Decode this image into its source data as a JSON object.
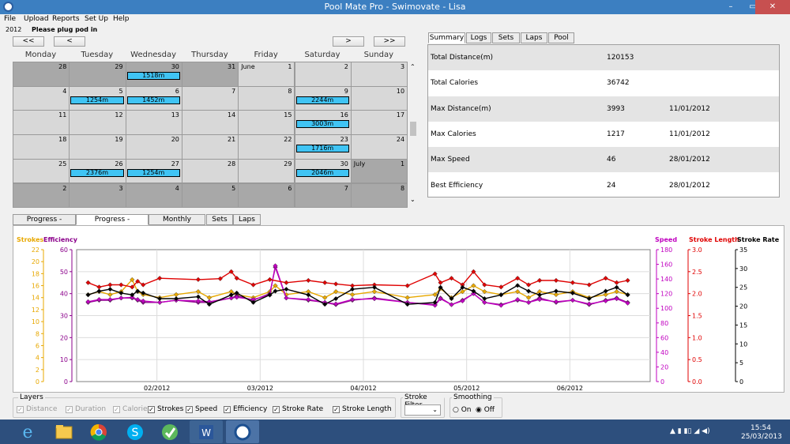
{
  "window": {
    "title": "Pool Mate Pro - Swimovate - Lisa",
    "minimize": "–",
    "maximize": "▭",
    "close": "✕"
  },
  "menu": [
    "File",
    "Upload",
    "Reports",
    "Set Up",
    "Help"
  ],
  "status": {
    "year": "2012",
    "message": "Please plug pod in"
  },
  "nav": {
    "first": "<<",
    "prev": "<",
    "next": ">",
    "last": ">>"
  },
  "days": [
    "Monday",
    "Tuesday",
    "Wednesday",
    "Thursday",
    "Friday",
    "Saturday",
    "Sunday"
  ],
  "calendar": {
    "weeks": [
      [
        {
          "n": "28",
          "t": "o"
        },
        {
          "n": "29",
          "t": "o"
        },
        {
          "n": "30",
          "t": "o",
          "s": "1518m"
        },
        {
          "n": "31",
          "t": "o"
        },
        {
          "n": "1",
          "t": "c",
          "m": "June"
        },
        {
          "n": "2",
          "t": "c"
        },
        {
          "n": "3",
          "t": "c"
        }
      ],
      [
        {
          "n": "4",
          "t": "c"
        },
        {
          "n": "5",
          "t": "c",
          "s": "1254m"
        },
        {
          "n": "6",
          "t": "c",
          "s": "1452m"
        },
        {
          "n": "7",
          "t": "c"
        },
        {
          "n": "8",
          "t": "c"
        },
        {
          "n": "9",
          "t": "c",
          "s": "2244m"
        },
        {
          "n": "10",
          "t": "c"
        }
      ],
      [
        {
          "n": "11",
          "t": "c"
        },
        {
          "n": "12",
          "t": "c"
        },
        {
          "n": "13",
          "t": "c"
        },
        {
          "n": "14",
          "t": "c"
        },
        {
          "n": "15",
          "t": "c"
        },
        {
          "n": "16",
          "t": "c",
          "s": "3003m"
        },
        {
          "n": "17",
          "t": "c"
        }
      ],
      [
        {
          "n": "18",
          "t": "c"
        },
        {
          "n": "19",
          "t": "c"
        },
        {
          "n": "20",
          "t": "c"
        },
        {
          "n": "21",
          "t": "c"
        },
        {
          "n": "22",
          "t": "c"
        },
        {
          "n": "23",
          "t": "c",
          "s": "1716m"
        },
        {
          "n": "24",
          "t": "c"
        }
      ],
      [
        {
          "n": "25",
          "t": "c"
        },
        {
          "n": "26",
          "t": "c",
          "s": "2376m"
        },
        {
          "n": "27",
          "t": "c",
          "s": "1254m"
        },
        {
          "n": "28",
          "t": "c"
        },
        {
          "n": "29",
          "t": "c"
        },
        {
          "n": "30",
          "t": "c",
          "s": "2046m"
        },
        {
          "n": "1",
          "t": "o",
          "m": "July"
        }
      ],
      [
        {
          "n": "2",
          "t": "o"
        },
        {
          "n": "3",
          "t": "o"
        },
        {
          "n": "4",
          "t": "o"
        },
        {
          "n": "5",
          "t": "o"
        },
        {
          "n": "6",
          "t": "o"
        },
        {
          "n": "7",
          "t": "o"
        },
        {
          "n": "8",
          "t": "o"
        }
      ]
    ]
  },
  "summary_tabs": [
    "Summary",
    "Logs",
    "Sets",
    "Laps",
    "Pool"
  ],
  "summary": [
    {
      "label": "Total Distance(m)",
      "value": "120153",
      "date": ""
    },
    {
      "label": "Total Calories",
      "value": "36742",
      "date": ""
    },
    {
      "label": "Max Distance(m)",
      "value": "3993",
      "date": "11/01/2012"
    },
    {
      "label": "Max Calories",
      "value": "1217",
      "date": "11/01/2012"
    },
    {
      "label": "Max Speed",
      "value": "46",
      "date": "28/01/2012"
    },
    {
      "label": "Best Efficiency",
      "value": "24",
      "date": "28/01/2012"
    }
  ],
  "chart_tabs": [
    "Progress - Volume",
    "Progress - Technique",
    "Monthly Volume",
    "Sets",
    "Laps"
  ],
  "chart_titles": {
    "strokes": "Strokes",
    "efficiency": "Efficiency",
    "speed": "Speed",
    "stroke_length": "Stroke Length",
    "stroke_rate": "Stroke Rate"
  },
  "chart_data": {
    "type": "line",
    "x_ticks": [
      "02/2012",
      "03/2012",
      "04/2012",
      "05/2012",
      "06/2012"
    ],
    "axes": {
      "strokes": {
        "color": "#e8a800",
        "ticks": [
          "0",
          "2",
          "4",
          "6",
          "8",
          "10",
          "12",
          "14",
          "16",
          "18",
          "20",
          "22"
        ],
        "ylim": [
          0,
          22
        ]
      },
      "efficiency": {
        "color": "#8b008b",
        "ticks": [
          "0",
          "10",
          "20",
          "30",
          "40",
          "50",
          "60"
        ],
        "ylim": [
          0,
          60
        ]
      },
      "speed": {
        "color": "#c000c0",
        "ticks": [
          "0",
          "20",
          "40",
          "60",
          "80",
          "100",
          "120",
          "140",
          "160",
          "180"
        ],
        "ylim": [
          0,
          180
        ]
      },
      "stroke_length": {
        "color": "#e00000",
        "ticks": [
          "0.0",
          "0.5",
          "1.0",
          "1.5",
          "2.0",
          "2.5",
          "3.0"
        ],
        "ylim": [
          0,
          3
        ]
      },
      "stroke_rate": {
        "color": "#000000",
        "ticks": [
          "0",
          "5",
          "10",
          "15",
          "20",
          "25",
          "30",
          "35"
        ],
        "ylim": [
          0,
          35
        ]
      }
    },
    "series": [
      {
        "name": "Strokes",
        "color": "#e8a800",
        "points": [
          [
            0,
            14.5
          ],
          [
            2,
            15
          ],
          [
            4,
            14.5
          ],
          [
            6,
            15
          ],
          [
            8,
            17
          ],
          [
            9,
            15
          ],
          [
            10,
            14.5
          ],
          [
            13,
            14
          ],
          [
            16,
            14.5
          ],
          [
            20,
            15
          ],
          [
            22,
            14
          ],
          [
            26,
            15
          ],
          [
            27,
            14.5
          ],
          [
            30,
            14
          ],
          [
            33,
            15
          ],
          [
            34,
            16
          ],
          [
            36,
            14.5
          ],
          [
            40,
            15
          ],
          [
            43,
            14
          ],
          [
            45,
            15
          ],
          [
            48,
            14.5
          ],
          [
            52,
            15
          ],
          [
            58,
            14
          ],
          [
            63,
            14.5
          ],
          [
            64,
            15.5
          ],
          [
            66,
            14
          ],
          [
            68,
            15
          ],
          [
            70,
            16
          ],
          [
            72,
            15
          ],
          [
            75,
            14.5
          ],
          [
            78,
            15
          ],
          [
            80,
            14
          ],
          [
            82,
            15
          ],
          [
            85,
            14.5
          ],
          [
            88,
            15
          ],
          [
            91,
            14
          ],
          [
            94,
            14.5
          ],
          [
            96,
            15
          ],
          [
            98,
            14.5
          ]
        ]
      },
      {
        "name": "Efficiency",
        "color": "#8b008b",
        "points": [
          [
            0,
            36
          ],
          [
            2,
            37
          ],
          [
            4,
            37
          ],
          [
            6,
            38
          ],
          [
            8,
            38
          ],
          [
            9,
            37
          ],
          [
            10,
            36
          ],
          [
            13,
            36
          ],
          [
            16,
            37
          ],
          [
            20,
            36
          ],
          [
            22,
            36
          ],
          [
            26,
            38
          ],
          [
            27,
            39
          ],
          [
            30,
            37
          ],
          [
            33,
            40
          ],
          [
            34,
            52
          ],
          [
            36,
            38
          ],
          [
            40,
            37
          ],
          [
            43,
            36
          ],
          [
            45,
            35
          ],
          [
            48,
            37
          ],
          [
            52,
            38
          ],
          [
            58,
            36
          ],
          [
            63,
            35
          ],
          [
            64,
            38
          ],
          [
            66,
            35
          ],
          [
            68,
            37
          ],
          [
            70,
            40
          ],
          [
            72,
            36
          ],
          [
            75,
            35
          ],
          [
            78,
            37
          ],
          [
            80,
            36
          ],
          [
            82,
            38
          ],
          [
            85,
            36
          ],
          [
            88,
            37
          ],
          [
            91,
            35
          ],
          [
            94,
            37
          ],
          [
            96,
            38
          ],
          [
            98,
            36
          ]
        ]
      },
      {
        "name": "Speed",
        "color": "#c000c0",
        "points": [
          [
            0,
            109
          ],
          [
            2,
            112
          ],
          [
            4,
            112
          ],
          [
            6,
            114
          ],
          [
            8,
            115
          ],
          [
            9,
            112
          ],
          [
            10,
            110
          ],
          [
            13,
            108
          ],
          [
            16,
            111
          ],
          [
            20,
            110
          ],
          [
            22,
            109
          ],
          [
            26,
            114
          ],
          [
            27,
            115
          ],
          [
            30,
            112
          ],
          [
            33,
            118
          ],
          [
            34,
            158
          ],
          [
            36,
            114
          ],
          [
            40,
            112
          ],
          [
            43,
            108
          ],
          [
            45,
            106
          ],
          [
            48,
            112
          ],
          [
            52,
            113
          ],
          [
            58,
            108
          ],
          [
            63,
            104
          ],
          [
            64,
            113
          ],
          [
            66,
            105
          ],
          [
            68,
            110
          ],
          [
            70,
            120
          ],
          [
            72,
            108
          ],
          [
            75,
            104
          ],
          [
            78,
            112
          ],
          [
            80,
            108
          ],
          [
            82,
            112
          ],
          [
            85,
            109
          ],
          [
            88,
            111
          ],
          [
            91,
            106
          ],
          [
            94,
            110
          ],
          [
            96,
            113
          ],
          [
            98,
            107
          ]
        ]
      },
      {
        "name": "Stroke Length",
        "color": "#e00000",
        "points": [
          [
            0,
            2.25
          ],
          [
            2,
            2.15
          ],
          [
            4,
            2.2
          ],
          [
            6,
            2.2
          ],
          [
            8,
            2.15
          ],
          [
            9,
            2.28
          ],
          [
            10,
            2.2
          ],
          [
            13,
            2.35
          ],
          [
            20,
            2.32
          ],
          [
            24,
            2.34
          ],
          [
            26,
            2.5
          ],
          [
            27,
            2.35
          ],
          [
            30,
            2.2
          ],
          [
            33,
            2.32
          ],
          [
            36,
            2.25
          ],
          [
            40,
            2.3
          ],
          [
            43,
            2.25
          ],
          [
            45,
            2.22
          ],
          [
            48,
            2.18
          ],
          [
            52,
            2.2
          ],
          [
            58,
            2.18
          ],
          [
            63,
            2.45
          ],
          [
            64,
            2.25
          ],
          [
            66,
            2.35
          ],
          [
            68,
            2.2
          ],
          [
            70,
            2.5
          ],
          [
            72,
            2.2
          ],
          [
            75,
            2.15
          ],
          [
            78,
            2.35
          ],
          [
            80,
            2.2
          ],
          [
            82,
            2.3
          ],
          [
            85,
            2.3
          ],
          [
            88,
            2.25
          ],
          [
            91,
            2.2
          ],
          [
            94,
            2.35
          ],
          [
            96,
            2.25
          ],
          [
            98,
            2.3
          ]
        ]
      },
      {
        "name": "Stroke Rate",
        "color": "#000000",
        "points": [
          [
            0,
            23
          ],
          [
            2,
            24
          ],
          [
            4,
            24.5
          ],
          [
            6,
            23.5
          ],
          [
            8,
            23
          ],
          [
            9,
            24
          ],
          [
            10,
            23.5
          ],
          [
            13,
            22
          ],
          [
            16,
            22
          ],
          [
            20,
            22.5
          ],
          [
            22,
            20.5
          ],
          [
            26,
            23
          ],
          [
            27,
            23.5
          ],
          [
            30,
            21
          ],
          [
            33,
            23
          ],
          [
            34,
            24
          ],
          [
            36,
            24.5
          ],
          [
            40,
            23
          ],
          [
            43,
            20.5
          ],
          [
            45,
            22
          ],
          [
            48,
            24.5
          ],
          [
            52,
            25
          ],
          [
            58,
            20.5
          ],
          [
            63,
            21
          ],
          [
            64,
            25
          ],
          [
            66,
            22
          ],
          [
            68,
            25
          ],
          [
            70,
            24
          ],
          [
            72,
            22
          ],
          [
            75,
            23
          ],
          [
            78,
            25.5
          ],
          [
            80,
            24
          ],
          [
            82,
            23
          ],
          [
            85,
            24
          ],
          [
            88,
            23.5
          ],
          [
            91,
            22
          ],
          [
            94,
            24
          ],
          [
            96,
            25
          ],
          [
            98,
            23
          ]
        ]
      }
    ]
  },
  "layers": {
    "title": "Layers",
    "items": [
      {
        "label": "Distance",
        "checked": true,
        "enabled": false
      },
      {
        "label": "Duration",
        "checked": true,
        "enabled": false
      },
      {
        "label": "Calories",
        "checked": true,
        "enabled": false
      },
      {
        "label": "Strokes",
        "checked": true,
        "enabled": true
      },
      {
        "label": "Speed",
        "checked": true,
        "enabled": true
      },
      {
        "label": "Efficiency",
        "checked": true,
        "enabled": true
      },
      {
        "label": "Stroke Rate",
        "checked": true,
        "enabled": true
      },
      {
        "label": "Stroke Length",
        "checked": true,
        "enabled": true
      }
    ]
  },
  "stroke_filter": {
    "title": "Stroke Filter",
    "value": ""
  },
  "smoothing": {
    "title": "Smoothing",
    "on": "On",
    "off": "Off",
    "selected": "Off"
  },
  "taskbar": {
    "time": "15:54",
    "date": "25/03/2013",
    "apps": [
      "ie-icon",
      "explorer-icon",
      "chrome-icon",
      "skype-icon",
      "app-icon",
      "word-icon",
      "poolmate-icon"
    ]
  }
}
